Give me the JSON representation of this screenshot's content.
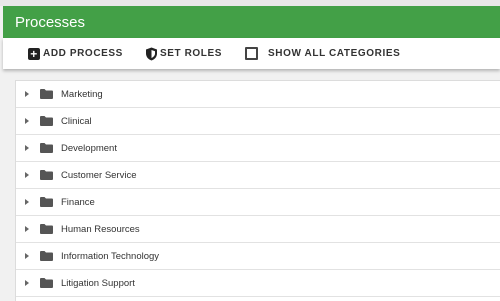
{
  "header": {
    "title": "Processes"
  },
  "toolbar": {
    "add_process_label": "ADD PROCESS",
    "set_roles_label": "SET ROLES",
    "show_all_categories_label": "SHOW ALL CATEGORIES",
    "show_all_categories_checked": false
  },
  "tree": {
    "items": [
      {
        "label": "Marketing"
      },
      {
        "label": "Clinical"
      },
      {
        "label": "Development"
      },
      {
        "label": "Customer Service"
      },
      {
        "label": "Finance"
      },
      {
        "label": "Human Resources"
      },
      {
        "label": "Information Technology"
      },
      {
        "label": "Litigation Support"
      }
    ]
  },
  "colors": {
    "header_bg": "#43a047",
    "header_text": "#ffffff",
    "page_bg": "#f1f1f1"
  },
  "icons": {
    "add": "add-box-icon",
    "roles": "shield-icon",
    "expand": "caret-right-icon",
    "folder": "folder-icon"
  }
}
